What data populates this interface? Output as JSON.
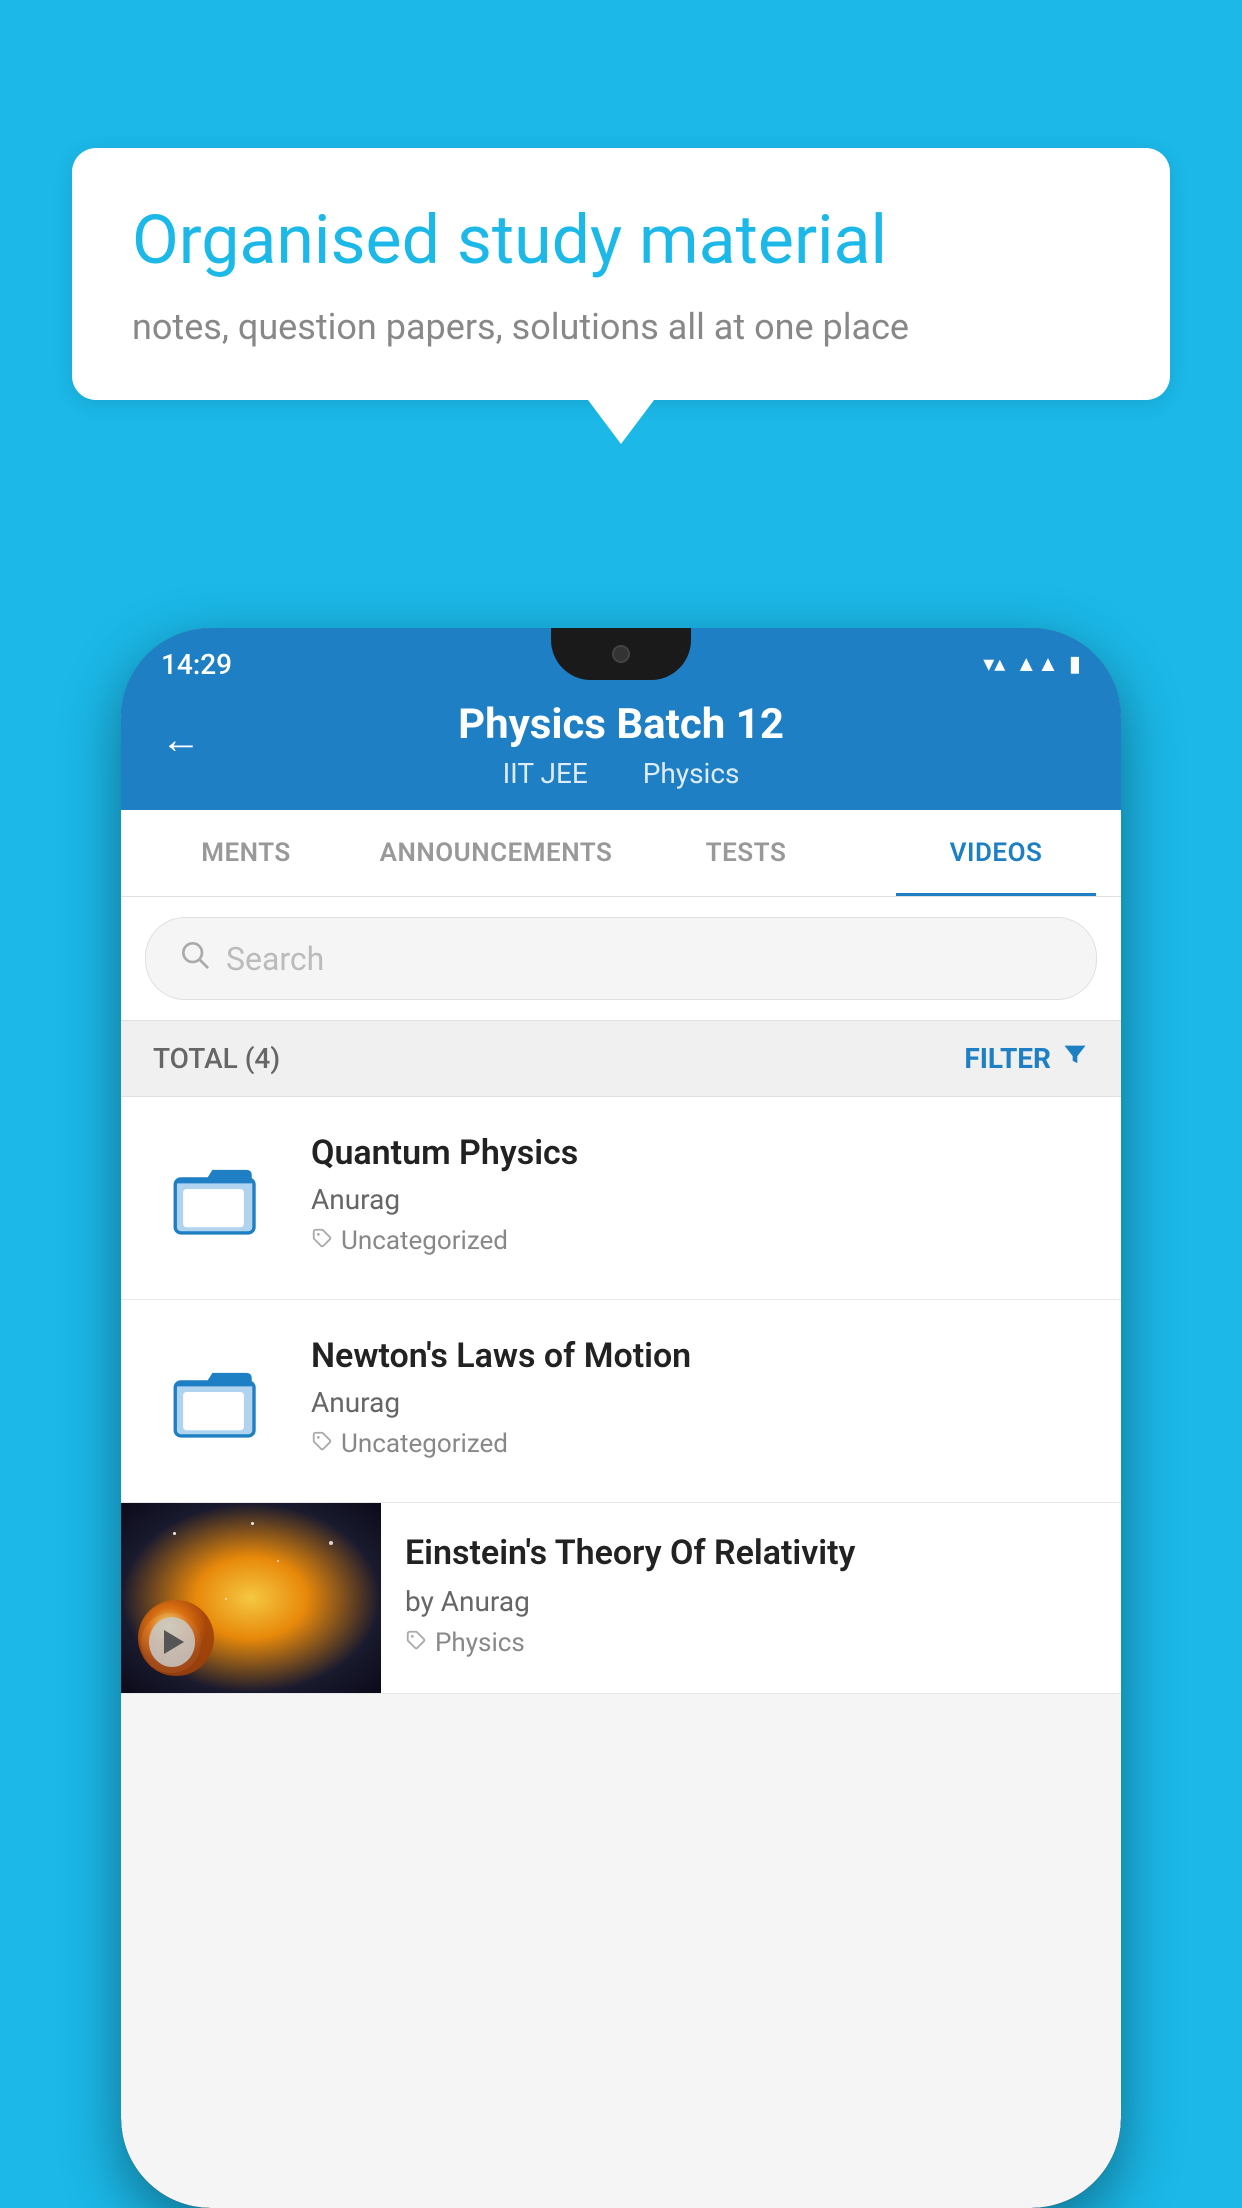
{
  "background_color": "#1bb8e8",
  "speech_bubble": {
    "title": "Organised study material",
    "subtitle": "notes, question papers, solutions all at one place"
  },
  "phone": {
    "status_bar": {
      "time": "14:29",
      "wifi": "▼",
      "signal": "▲",
      "battery": "▮"
    },
    "header": {
      "back_label": "←",
      "title": "Physics Batch 12",
      "subtitle_left": "IIT JEE",
      "subtitle_right": "Physics"
    },
    "tabs": [
      {
        "label": "MENTS",
        "active": false
      },
      {
        "label": "ANNOUNCEMENTS",
        "active": false
      },
      {
        "label": "TESTS",
        "active": false
      },
      {
        "label": "VIDEOS",
        "active": true
      }
    ],
    "search": {
      "placeholder": "Search"
    },
    "filter_bar": {
      "total_label": "TOTAL (4)",
      "filter_label": "FILTER"
    },
    "videos": [
      {
        "id": 1,
        "title": "Quantum Physics",
        "author": "Anurag",
        "tag": "Uncategorized",
        "type": "folder"
      },
      {
        "id": 2,
        "title": "Newton's Laws of Motion",
        "author": "Anurag",
        "tag": "Uncategorized",
        "type": "folder"
      },
      {
        "id": 3,
        "title": "Einstein's Theory Of Relativity",
        "author": "by Anurag",
        "tag": "Physics",
        "type": "video"
      }
    ]
  }
}
